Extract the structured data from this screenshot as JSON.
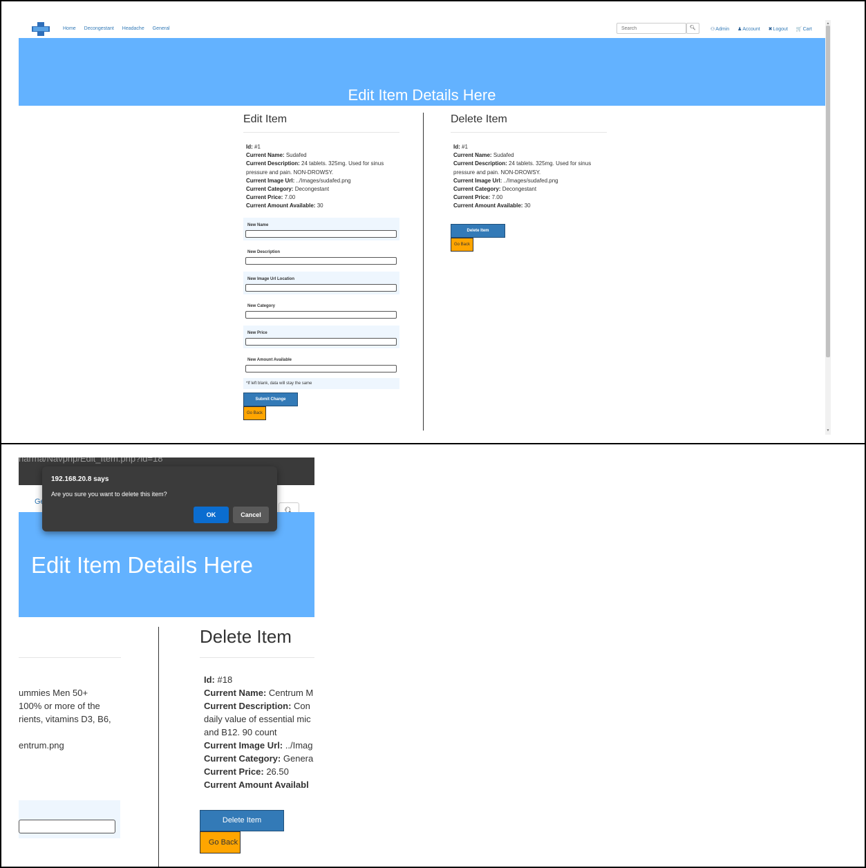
{
  "top": {
    "nav": {
      "links": [
        "Home",
        "Decongestant",
        "Headache",
        "General"
      ],
      "search_placeholder": "Search",
      "right_links": [
        {
          "icon": "admin-icon",
          "glyph": "⚇",
          "label": "Admin"
        },
        {
          "icon": "user-icon",
          "glyph": "♟",
          "label": "Account"
        },
        {
          "icon": "close-icon",
          "glyph": "✖",
          "label": "Logout"
        },
        {
          "icon": "cart-icon",
          "glyph": "🛒",
          "label": "Cart"
        }
      ]
    },
    "hero_title": "Edit Item Details Here",
    "edit": {
      "title": "Edit Item",
      "id_label": "Id:",
      "id_value": "#1",
      "name_label": "Current Name:",
      "name_value": "Sudafed",
      "desc_label": "Current Description:",
      "desc_value": "24 tablets. 325mg. Used for sinus pressure and pain. NON-DROWSY.",
      "url_label": "Current Image Url:",
      "url_value": "../Images/sudafed.png",
      "cat_label": "Current Category:",
      "cat_value": "Decongestant",
      "price_label": "Current Price:",
      "price_value": "7.00",
      "amount_label": "Current Amount Available:",
      "amount_value": "30",
      "fields": [
        "New Name",
        "New Description",
        "New Image Url Location",
        "New Category",
        "New Price",
        "New Amount Available"
      ],
      "note": "*If left blank, data will stay the same",
      "submit_label": "Submit Change",
      "back_label": "Go Back"
    },
    "delete": {
      "title": "Delete Item",
      "id_label": "Id:",
      "id_value": "#1",
      "name_label": "Current Name:",
      "name_value": "Sudafed",
      "desc_label": "Current Description:",
      "desc_value": "24 tablets. 325mg. Used for sinus pressure and pain. NON-DROWSY.",
      "url_label": "Current Image Url:",
      "url_value": "../Images/sudafed.png",
      "cat_label": "Current Category:",
      "cat_value": "Decongestant",
      "price_label": "Current Price:",
      "price_value": "7.00",
      "amount_label": "Current Amount Available:",
      "amount_value": "30",
      "delete_label": "Delete Item",
      "back_label": "Go Back"
    }
  },
  "bottom": {
    "url_fragment": "harma/Navphp/Edit_Item.php?id=18",
    "nav_fragment": "Ge",
    "hero_title": "Edit Item Details Here",
    "left_fragments": "ummies Men 50+\n100% or more of the\nrients, vitamins D3, B6,\n\nentrum.png",
    "delete": {
      "title": "Delete Item",
      "id_label": "Id:",
      "id_value": "#18",
      "name_label": "Current Name:",
      "name_value": "Centrum M",
      "desc_label": "Current Description:",
      "desc_value": "Con",
      "desc_line2": "daily value of essential mic",
      "desc_line3": "and B12. 90 count",
      "url_label": "Current Image Url:",
      "url_value": "../Imag",
      "cat_label": "Current Category:",
      "cat_value": "Genera",
      "price_label": "Current Price:",
      "price_value": "26.50",
      "amount_label": "Current Amount Availabl",
      "delete_label": "Delete Item",
      "back_label": "Go Back"
    },
    "dialog": {
      "origin": "192.168.20.8 says",
      "message": "Are you sure you want to delete this item?",
      "ok": "OK",
      "cancel": "Cancel"
    }
  },
  "colors": {
    "hero": "#63b2ff",
    "primary": "#337ab7",
    "back": "#ffa500",
    "dialog_ok": "#0b6dd0"
  }
}
